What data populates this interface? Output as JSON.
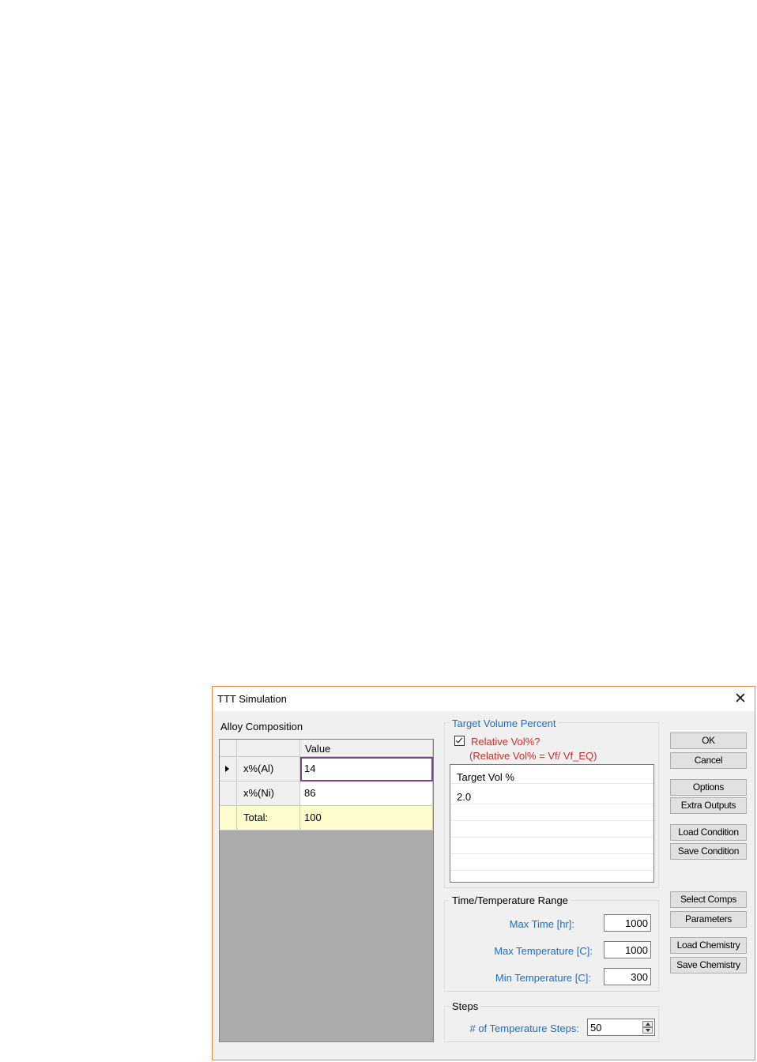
{
  "window": {
    "title": "TTT Simulation",
    "close_glyph": "✕"
  },
  "alloy": {
    "group_title": "Alloy Composition",
    "columns": {
      "name": "",
      "value": "Value"
    },
    "rows": [
      {
        "name": "x%(Al)",
        "value": "14"
      },
      {
        "name": "x%(Ni)",
        "value": "86"
      }
    ],
    "total": {
      "name": "Total:",
      "value": "100"
    }
  },
  "target_volume": {
    "group_title": "Target Volume Percent",
    "relative_checkbox": {
      "label": "Relative Vol%?",
      "checked": true
    },
    "relative_note": "(Relative Vol% = Vf/ Vf_EQ)",
    "list_header": "Target Vol %",
    "list_values": [
      "2.0"
    ]
  },
  "time_temp": {
    "group_title": "Time/Temperature Range",
    "max_time": {
      "label": "Max Time [hr]:",
      "value": "1000"
    },
    "max_temp": {
      "label": "Max Temperature [C]:",
      "value": "1000"
    },
    "min_temp": {
      "label": "Min Temperature [C]:",
      "value": "300"
    }
  },
  "steps": {
    "group_title": "Steps",
    "temp_steps": {
      "label": "# of Temperature Steps:",
      "value": "50"
    }
  },
  "buttons": {
    "ok": "OK",
    "cancel": "Cancel",
    "options": "Options",
    "extra_outputs": "Extra Outputs",
    "load_condition": "Load Condition",
    "save_condition": "Save Condition",
    "select_comps": "Select Comps",
    "parameters": "Parameters",
    "load_chemistry": "Load Chemistry",
    "save_chemistry": "Save Chemistry"
  },
  "colors": {
    "label_blue": "#1a6fc4",
    "label_red": "#c0322b",
    "window_border": "#e08a3c",
    "total_row": "#fcfccc"
  }
}
